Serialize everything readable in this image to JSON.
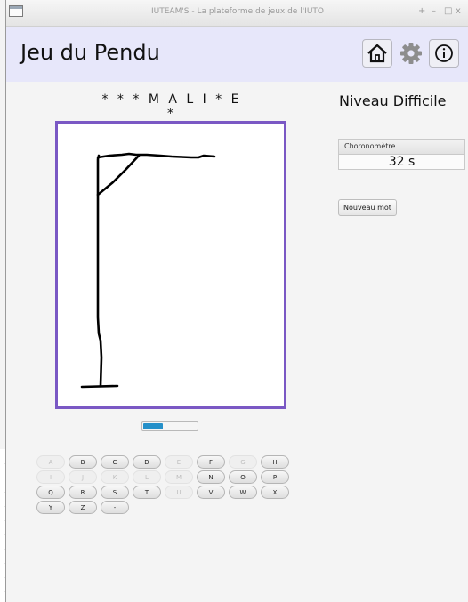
{
  "window": {
    "title": "IUTEAM'S - La plateforme de jeux de l'IUTO",
    "controls": [
      "+",
      "–",
      "□",
      "x"
    ]
  },
  "header": {
    "title": "Jeu du Pendu",
    "buttons": [
      {
        "name": "home-button",
        "icon": "home-icon"
      },
      {
        "name": "settings-button",
        "icon": "gear-icon"
      },
      {
        "name": "info-button",
        "icon": "info-icon"
      }
    ]
  },
  "game": {
    "hidden_word": "* * * M A L I * E *",
    "level": "Niveau Difficile",
    "progress": 0.35
  },
  "timer": {
    "label": "Choronomètre",
    "value": "32 s"
  },
  "new_word_label": "Nouveau mot",
  "keyboard": [
    [
      {
        "k": "A",
        "used": true
      },
      {
        "k": "B",
        "used": false
      },
      {
        "k": "C",
        "used": false
      },
      {
        "k": "D",
        "used": false
      },
      {
        "k": "E",
        "used": true
      },
      {
        "k": "F",
        "used": false
      },
      {
        "k": "G",
        "used": true
      },
      {
        "k": "H",
        "used": false
      }
    ],
    [
      {
        "k": "I",
        "used": true
      },
      {
        "k": "J",
        "used": true
      },
      {
        "k": "K",
        "used": true
      },
      {
        "k": "L",
        "used": true
      },
      {
        "k": "M",
        "used": true
      },
      {
        "k": "N",
        "used": false
      },
      {
        "k": "O",
        "used": false
      },
      {
        "k": "P",
        "used": false
      }
    ],
    [
      {
        "k": "Q",
        "used": false
      },
      {
        "k": "R",
        "used": false
      },
      {
        "k": "S",
        "used": false
      },
      {
        "k": "T",
        "used": false
      },
      {
        "k": "U",
        "used": true
      },
      {
        "k": "V",
        "used": false
      },
      {
        "k": "W",
        "used": false
      },
      {
        "k": "X",
        "used": false
      }
    ],
    [
      {
        "k": "Y",
        "used": false
      },
      {
        "k": "Z",
        "used": false
      },
      {
        "k": "-",
        "used": false
      }
    ]
  ],
  "colors": {
    "header_bg": "#e7e7fa",
    "board_border": "#7a58c4",
    "progress_fill": "#2590c9"
  }
}
